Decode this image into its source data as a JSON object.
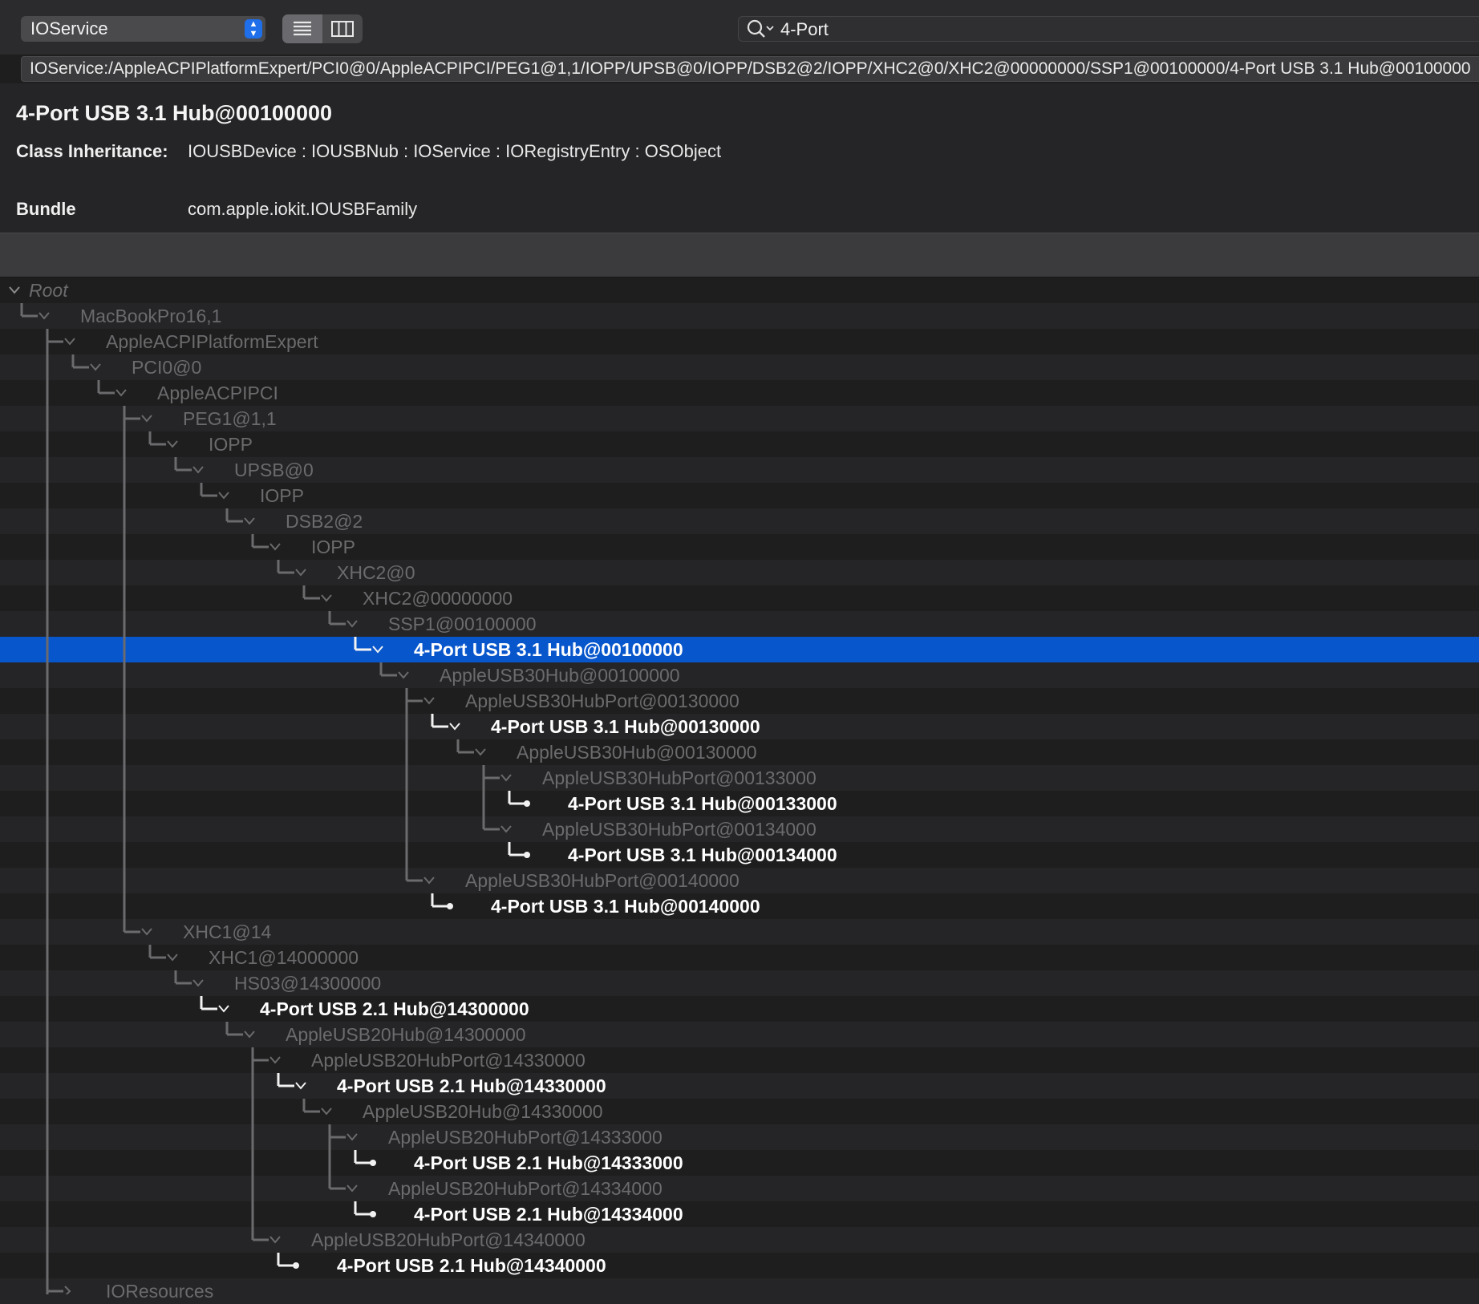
{
  "toolbar": {
    "plane": "IOService",
    "search_value": "4-Port",
    "list_view_icon": "list-view-icon",
    "column_view_icon": "column-view-icon"
  },
  "path": "IOService:/AppleACPIPlatformExpert/PCI0@0/AppleACPIPCI/PEG1@1,1/IOPP/UPSB@0/IOPP/DSB2@2/IOPP/XHC2@0/XHC2@00000000/SSP1@00100000/4-Port USB 3.1 Hub@00100000",
  "info": {
    "title": "4-Port USB 3.1 Hub@00100000",
    "inheritance_label": "Class Inheritance:",
    "inheritance_value": "IOUSBDevice : IOUSBNub : IOService : IORegistryEntry : OSObject",
    "bundle_label": "Bundle",
    "bundle_value": "com.apple.iokit.IOUSBFamily"
  },
  "colors": {
    "selection": "#0856cc",
    "dim_text": "#6b6b6e",
    "match_text": "#ffffff"
  },
  "tree": [
    {
      "label": "Root",
      "depth": 0,
      "kind": "expanded",
      "state": "root"
    },
    {
      "label": "MacBookPro16,1",
      "depth": 1,
      "kind": "expanded",
      "state": "dim"
    },
    {
      "label": "AppleACPIPlatformExpert",
      "depth": 2,
      "kind": "expanded",
      "state": "dim"
    },
    {
      "label": "PCI0@0",
      "depth": 3,
      "kind": "expanded",
      "state": "dim"
    },
    {
      "label": "AppleACPIPCI",
      "depth": 4,
      "kind": "expanded",
      "state": "dim"
    },
    {
      "label": "PEG1@1,1",
      "depth": 5,
      "kind": "expanded",
      "state": "dim"
    },
    {
      "label": "IOPP",
      "depth": 6,
      "kind": "expanded",
      "state": "dim"
    },
    {
      "label": "UPSB@0",
      "depth": 7,
      "kind": "expanded",
      "state": "dim"
    },
    {
      "label": "IOPP",
      "depth": 8,
      "kind": "expanded",
      "state": "dim"
    },
    {
      "label": "DSB2@2",
      "depth": 9,
      "kind": "expanded",
      "state": "dim"
    },
    {
      "label": "IOPP",
      "depth": 10,
      "kind": "expanded",
      "state": "dim"
    },
    {
      "label": "XHC2@0",
      "depth": 11,
      "kind": "expanded",
      "state": "dim"
    },
    {
      "label": "XHC2@00000000",
      "depth": 12,
      "kind": "expanded",
      "state": "dim"
    },
    {
      "label": "SSP1@00100000",
      "depth": 13,
      "kind": "expanded",
      "state": "dim"
    },
    {
      "label": "4-Port USB 3.1 Hub@00100000",
      "depth": 14,
      "kind": "expanded",
      "state": "selected"
    },
    {
      "label": "AppleUSB30Hub@00100000",
      "depth": 15,
      "kind": "expanded",
      "state": "dim"
    },
    {
      "label": "AppleUSB30HubPort@00130000",
      "depth": 16,
      "kind": "expanded",
      "state": "dim"
    },
    {
      "label": "4-Port USB 3.1 Hub@00130000",
      "depth": 17,
      "kind": "expanded",
      "state": "match"
    },
    {
      "label": "AppleUSB30Hub@00130000",
      "depth": 18,
      "kind": "expanded",
      "state": "dim"
    },
    {
      "label": "AppleUSB30HubPort@00133000",
      "depth": 19,
      "kind": "expanded",
      "state": "dim"
    },
    {
      "label": "4-Port USB 3.1 Hub@00133000",
      "depth": 20,
      "kind": "leaf",
      "state": "match"
    },
    {
      "label": "AppleUSB30HubPort@00134000",
      "depth": 19,
      "kind": "expanded",
      "state": "dim"
    },
    {
      "label": "4-Port USB 3.1 Hub@00134000",
      "depth": 20,
      "kind": "leaf",
      "state": "match"
    },
    {
      "label": "AppleUSB30HubPort@00140000",
      "depth": 16,
      "kind": "expanded",
      "state": "dim"
    },
    {
      "label": "4-Port USB 3.1 Hub@00140000",
      "depth": 17,
      "kind": "leaf",
      "state": "match"
    },
    {
      "label": "XHC1@14",
      "depth": 5,
      "kind": "expanded",
      "state": "dim"
    },
    {
      "label": "XHC1@14000000",
      "depth": 6,
      "kind": "expanded",
      "state": "dim"
    },
    {
      "label": "HS03@14300000",
      "depth": 7,
      "kind": "expanded",
      "state": "dim"
    },
    {
      "label": "4-Port USB 2.1 Hub@14300000",
      "depth": 8,
      "kind": "expanded",
      "state": "match"
    },
    {
      "label": "AppleUSB20Hub@14300000",
      "depth": 9,
      "kind": "expanded",
      "state": "dim"
    },
    {
      "label": "AppleUSB20HubPort@14330000",
      "depth": 10,
      "kind": "expanded",
      "state": "dim"
    },
    {
      "label": "4-Port USB 2.1 Hub@14330000",
      "depth": 11,
      "kind": "expanded",
      "state": "match"
    },
    {
      "label": "AppleUSB20Hub@14330000",
      "depth": 12,
      "kind": "expanded",
      "state": "dim"
    },
    {
      "label": "AppleUSB20HubPort@14333000",
      "depth": 13,
      "kind": "expanded",
      "state": "dim"
    },
    {
      "label": "4-Port USB 2.1 Hub@14333000",
      "depth": 14,
      "kind": "leaf",
      "state": "match"
    },
    {
      "label": "AppleUSB20HubPort@14334000",
      "depth": 13,
      "kind": "expanded",
      "state": "dim"
    },
    {
      "label": "4-Port USB 2.1 Hub@14334000",
      "depth": 14,
      "kind": "leaf",
      "state": "match"
    },
    {
      "label": "AppleUSB20HubPort@14340000",
      "depth": 10,
      "kind": "expanded",
      "state": "dim"
    },
    {
      "label": "4-Port USB 2.1 Hub@14340000",
      "depth": 11,
      "kind": "leaf",
      "state": "match"
    },
    {
      "label": "IOResources",
      "depth": 2,
      "kind": "collapsed",
      "state": "dim"
    }
  ]
}
